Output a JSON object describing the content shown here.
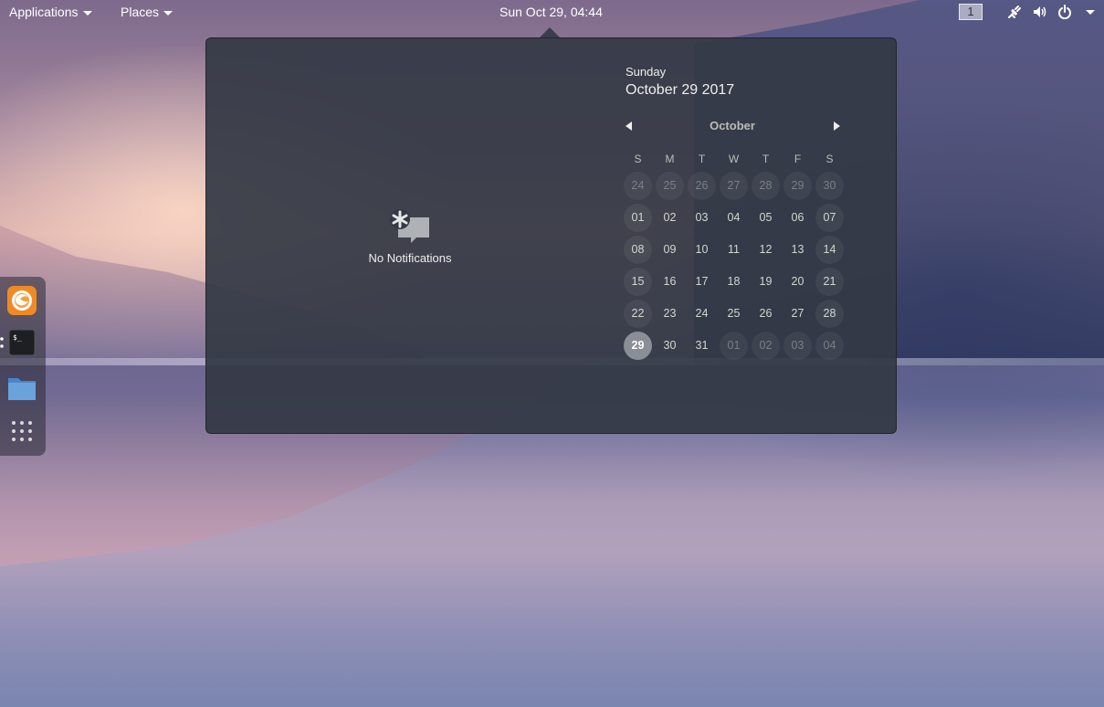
{
  "topbar": {
    "applications_label": "Applications",
    "places_label": "Places",
    "clock": "Sun Oct 29, 04:44",
    "workspace_number": "1"
  },
  "notifications": {
    "empty_label": "No Notifications"
  },
  "date_header": {
    "day_name": "Sunday",
    "full_date": "October 29 2017"
  },
  "calendar": {
    "month": "October",
    "weekday_headers": [
      "S",
      "M",
      "T",
      "W",
      "T",
      "F",
      "S"
    ],
    "weeks": [
      [
        "24",
        "25",
        "26",
        "27",
        "28",
        "29",
        "30"
      ],
      [
        "01",
        "02",
        "03",
        "04",
        "05",
        "06",
        "07"
      ],
      [
        "08",
        "09",
        "10",
        "11",
        "12",
        "13",
        "14"
      ],
      [
        "15",
        "16",
        "17",
        "18",
        "19",
        "20",
        "21"
      ],
      [
        "22",
        "23",
        "24",
        "25",
        "26",
        "27",
        "28"
      ],
      [
        "29",
        "30",
        "31",
        "01",
        "02",
        "03",
        "04"
      ]
    ],
    "today": "29"
  },
  "dock": {
    "items": [
      "firefox-icon",
      "terminal-icon",
      "files-icon",
      "app-grid-icon"
    ]
  },
  "colors": {
    "popup_bg": "#343945",
    "today_bg": "#8a8e96",
    "text": "#eeeeec"
  }
}
